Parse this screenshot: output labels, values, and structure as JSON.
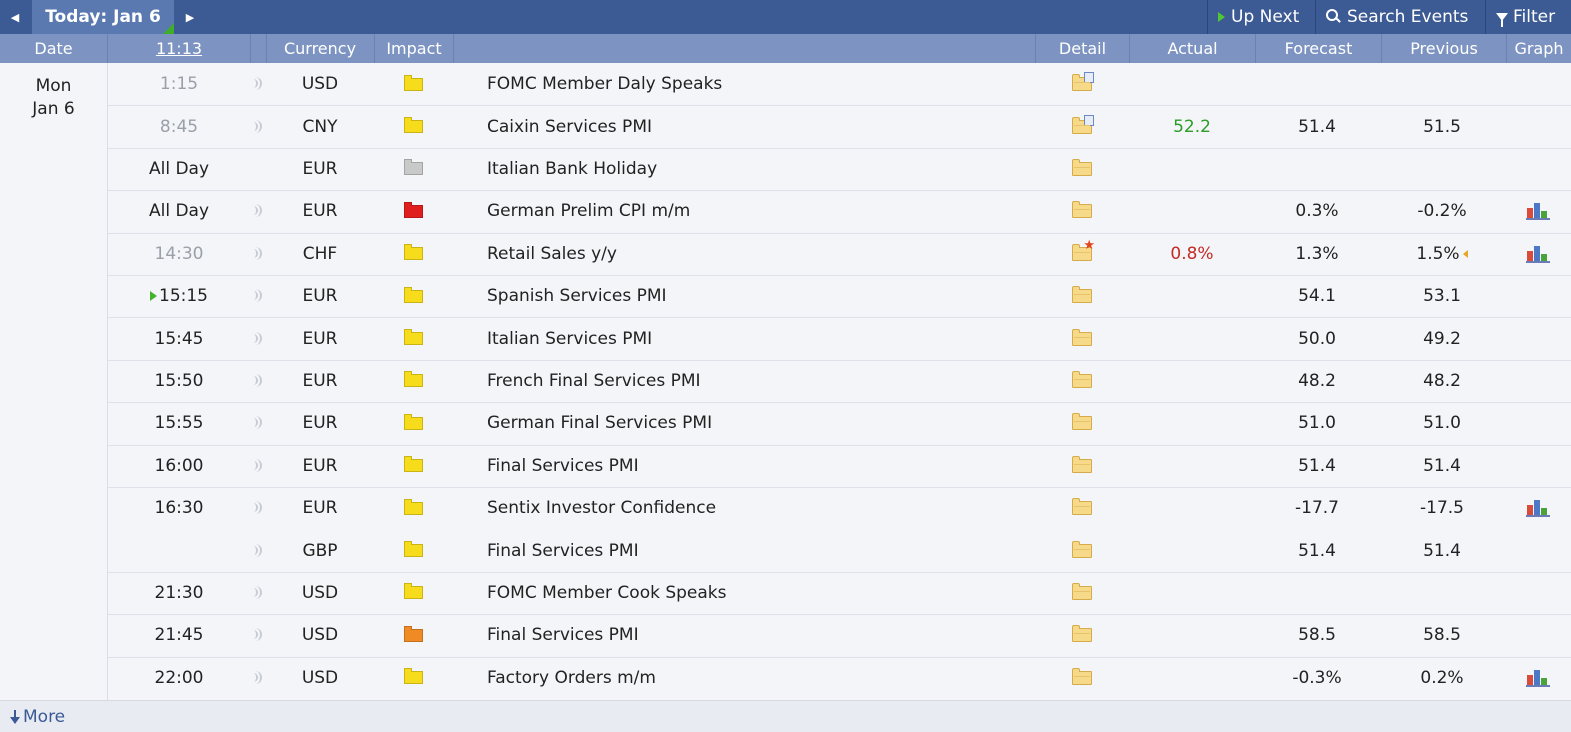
{
  "toolbar": {
    "prev_icon": "left-triangle-icon",
    "today_label": "Today: Jan 6",
    "next_icon": "right-triangle-icon",
    "up_next_label": "Up Next",
    "search_label": "Search Events",
    "filter_label": "Filter"
  },
  "columns": {
    "date": "Date",
    "clock": "11:13",
    "currency": "Currency",
    "impact": "Impact",
    "detail": "Detail",
    "actual": "Actual",
    "forecast": "Forecast",
    "previous": "Previous",
    "graph": "Graph"
  },
  "date": {
    "day": "Mon",
    "month_day": "Jan 6"
  },
  "impact_colors": {
    "yellow": "#f6dc1a",
    "gray": "#c9c9c9",
    "red": "#e01e1e",
    "orange": "#f08a24"
  },
  "events": [
    {
      "time": "1:15",
      "past": true,
      "sound": true,
      "currency": "USD",
      "impact": "yellow",
      "title": "FOMC Member Daly Speaks",
      "detail_icon": "folder-doc",
      "actual": "",
      "actual_dir": "",
      "forecast": "",
      "previous": "",
      "revised": false,
      "graph": false
    },
    {
      "time": "8:45",
      "past": true,
      "sound": true,
      "currency": "CNY",
      "impact": "yellow",
      "title": "Caixin Services PMI",
      "detail_icon": "folder-doc",
      "actual": "52.2",
      "actual_dir": "up",
      "forecast": "51.4",
      "previous": "51.5",
      "revised": false,
      "graph": false
    },
    {
      "time": "All Day",
      "past": false,
      "sound": false,
      "currency": "EUR",
      "impact": "gray",
      "title": "Italian Bank Holiday",
      "detail_icon": "folder",
      "actual": "",
      "actual_dir": "",
      "forecast": "",
      "previous": "",
      "revised": false,
      "graph": false
    },
    {
      "time": "All Day",
      "past": false,
      "sound": true,
      "currency": "EUR",
      "impact": "red",
      "title": "German Prelim CPI m/m",
      "detail_icon": "folder",
      "actual": "",
      "actual_dir": "",
      "forecast": "0.3%",
      "previous": "-0.2%",
      "revised": false,
      "graph": true
    },
    {
      "time": "14:30",
      "past": true,
      "sound": true,
      "currency": "CHF",
      "impact": "yellow",
      "title": "Retail Sales y/y",
      "detail_icon": "folder-star",
      "actual": "0.8%",
      "actual_dir": "down",
      "forecast": "1.3%",
      "previous": "1.5%",
      "revised": true,
      "graph": true
    },
    {
      "time": "15:15",
      "past": false,
      "upnext": true,
      "sound": true,
      "currency": "EUR",
      "impact": "yellow",
      "title": "Spanish Services PMI",
      "detail_icon": "folder",
      "actual": "",
      "actual_dir": "",
      "forecast": "54.1",
      "previous": "53.1",
      "revised": false,
      "graph": false
    },
    {
      "time": "15:45",
      "past": false,
      "sound": true,
      "currency": "EUR",
      "impact": "yellow",
      "title": "Italian Services PMI",
      "detail_icon": "folder",
      "actual": "",
      "actual_dir": "",
      "forecast": "50.0",
      "previous": "49.2",
      "revised": false,
      "graph": false
    },
    {
      "time": "15:50",
      "past": false,
      "sound": true,
      "currency": "EUR",
      "impact": "yellow",
      "title": "French Final Services PMI",
      "detail_icon": "folder",
      "actual": "",
      "actual_dir": "",
      "forecast": "48.2",
      "previous": "48.2",
      "revised": false,
      "graph": false
    },
    {
      "time": "15:55",
      "past": false,
      "sound": true,
      "currency": "EUR",
      "impact": "yellow",
      "title": "German Final Services PMI",
      "detail_icon": "folder",
      "actual": "",
      "actual_dir": "",
      "forecast": "51.0",
      "previous": "51.0",
      "revised": false,
      "graph": false
    },
    {
      "time": "16:00",
      "past": false,
      "sound": true,
      "currency": "EUR",
      "impact": "yellow",
      "title": "Final Services PMI",
      "detail_icon": "folder",
      "actual": "",
      "actual_dir": "",
      "forecast": "51.4",
      "previous": "51.4",
      "revised": false,
      "graph": false
    },
    {
      "time": "16:30",
      "past": false,
      "sound": true,
      "currency": "EUR",
      "impact": "yellow",
      "title": "Sentix Investor Confidence",
      "detail_icon": "folder",
      "actual": "",
      "actual_dir": "",
      "forecast": "-17.7",
      "previous": "-17.5",
      "revised": false,
      "graph": true
    },
    {
      "time": "",
      "past": false,
      "sound": true,
      "currency": "GBP",
      "impact": "yellow",
      "title": "Final Services PMI",
      "detail_icon": "folder",
      "actual": "",
      "actual_dir": "",
      "forecast": "51.4",
      "previous": "51.4",
      "revised": false,
      "graph": false
    },
    {
      "time": "21:30",
      "past": false,
      "sound": true,
      "currency": "USD",
      "impact": "yellow",
      "title": "FOMC Member Cook Speaks",
      "detail_icon": "folder",
      "actual": "",
      "actual_dir": "",
      "forecast": "",
      "previous": "",
      "revised": false,
      "graph": false
    },
    {
      "time": "21:45",
      "past": false,
      "sound": true,
      "currency": "USD",
      "impact": "orange",
      "title": "Final Services PMI",
      "detail_icon": "folder",
      "actual": "",
      "actual_dir": "",
      "forecast": "58.5",
      "previous": "58.5",
      "revised": false,
      "graph": false
    },
    {
      "time": "22:00",
      "past": false,
      "sound": true,
      "currency": "USD",
      "impact": "yellow",
      "title": "Factory Orders m/m",
      "detail_icon": "folder",
      "actual": "",
      "actual_dir": "",
      "forecast": "-0.3%",
      "previous": "0.2%",
      "revised": false,
      "graph": true
    }
  ],
  "footer": {
    "more_label": "More",
    "more_icon": "download-arrow-icon"
  }
}
